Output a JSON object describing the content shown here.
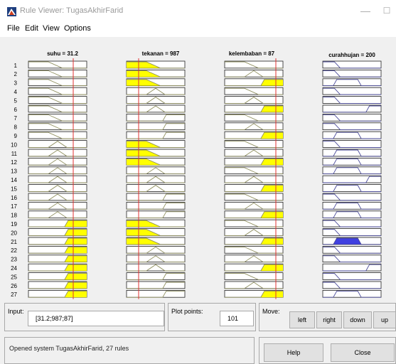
{
  "window": {
    "title": "Rule Viewer: TugasAkhirFarid",
    "minimize_glyph": "—",
    "maximize_glyph": "☐",
    "close_glyph": "✕"
  },
  "menu": [
    "File",
    "Edit",
    "View",
    "Options"
  ],
  "columns": [
    {
      "header": "suhu = 31.2",
      "input_value": 31.2,
      "range": [
        0,
        100
      ]
    },
    {
      "header": "tekanan = 987",
      "input_value": 987,
      "range": [
        0,
        100
      ]
    },
    {
      "header": "kelembaban = 87",
      "input_value": 87,
      "range": [
        0,
        100
      ]
    },
    {
      "header": "curahhujan = 200",
      "range": [
        0,
        100
      ]
    }
  ],
  "rules": [
    {
      "n": "1",
      "in": [
        {
          "mf": "low",
          "f": 0
        },
        {
          "mf": "low",
          "f": 1
        },
        {
          "mf": "low",
          "f": 0
        }
      ],
      "out": {
        "mf": "low",
        "f": 0
      }
    },
    {
      "n": "2",
      "in": [
        {
          "mf": "low",
          "f": 0
        },
        {
          "mf": "low",
          "f": 1
        },
        {
          "mf": "mid",
          "f": 0
        }
      ],
      "out": {
        "mf": "low",
        "f": 0
      }
    },
    {
      "n": "3",
      "in": [
        {
          "mf": "low",
          "f": 0
        },
        {
          "mf": "low",
          "f": 1
        },
        {
          "mf": "high",
          "f": 1
        }
      ],
      "out": {
        "mf": "mid",
        "f": 0
      }
    },
    {
      "n": "4",
      "in": [
        {
          "mf": "low",
          "f": 0
        },
        {
          "mf": "mid",
          "f": 0
        },
        {
          "mf": "low",
          "f": 0
        }
      ],
      "out": {
        "mf": "low",
        "f": 0
      }
    },
    {
      "n": "5",
      "in": [
        {
          "mf": "low",
          "f": 0
        },
        {
          "mf": "mid",
          "f": 0
        },
        {
          "mf": "mid",
          "f": 0
        }
      ],
      "out": {
        "mf": "low",
        "f": 0
      }
    },
    {
      "n": "6",
      "in": [
        {
          "mf": "low",
          "f": 0
        },
        {
          "mf": "mid",
          "f": 0
        },
        {
          "mf": "high",
          "f": 1
        }
      ],
      "out": {
        "mf": "high",
        "f": 0
      }
    },
    {
      "n": "7",
      "in": [
        {
          "mf": "low",
          "f": 0
        },
        {
          "mf": "high",
          "f": 0
        },
        {
          "mf": "low",
          "f": 0
        }
      ],
      "out": {
        "mf": "low",
        "f": 0
      }
    },
    {
      "n": "8",
      "in": [
        {
          "mf": "low",
          "f": 0
        },
        {
          "mf": "high",
          "f": 0
        },
        {
          "mf": "mid",
          "f": 0
        }
      ],
      "out": {
        "mf": "low",
        "f": 0
      }
    },
    {
      "n": "9",
      "in": [
        {
          "mf": "low",
          "f": 0
        },
        {
          "mf": "high",
          "f": 0
        },
        {
          "mf": "high",
          "f": 1
        }
      ],
      "out": {
        "mf": "mid",
        "f": 0
      }
    },
    {
      "n": "10",
      "in": [
        {
          "mf": "mid",
          "f": 0
        },
        {
          "mf": "low",
          "f": 1
        },
        {
          "mf": "low",
          "f": 0
        }
      ],
      "out": {
        "mf": "low",
        "f": 0
      }
    },
    {
      "n": "11",
      "in": [
        {
          "mf": "mid",
          "f": 0
        },
        {
          "mf": "low",
          "f": 1
        },
        {
          "mf": "mid",
          "f": 0
        }
      ],
      "out": {
        "mf": "mid",
        "f": 0
      }
    },
    {
      "n": "12",
      "in": [
        {
          "mf": "mid",
          "f": 0
        },
        {
          "mf": "low",
          "f": 1
        },
        {
          "mf": "high",
          "f": 1
        }
      ],
      "out": {
        "mf": "mid",
        "f": 0
      }
    },
    {
      "n": "13",
      "in": [
        {
          "mf": "mid",
          "f": 0
        },
        {
          "mf": "mid",
          "f": 0
        },
        {
          "mf": "low",
          "f": 0
        }
      ],
      "out": {
        "mf": "mid",
        "f": 0
      }
    },
    {
      "n": "14",
      "in": [
        {
          "mf": "mid",
          "f": 0
        },
        {
          "mf": "mid",
          "f": 0
        },
        {
          "mf": "mid",
          "f": 0
        }
      ],
      "out": {
        "mf": "high",
        "f": 0
      }
    },
    {
      "n": "15",
      "in": [
        {
          "mf": "mid",
          "f": 0
        },
        {
          "mf": "mid",
          "f": 0
        },
        {
          "mf": "high",
          "f": 1
        }
      ],
      "out": {
        "mf": "mid",
        "f": 0
      }
    },
    {
      "n": "16",
      "in": [
        {
          "mf": "mid",
          "f": 0
        },
        {
          "mf": "high",
          "f": 0
        },
        {
          "mf": "low",
          "f": 0
        }
      ],
      "out": {
        "mf": "low",
        "f": 0
      }
    },
    {
      "n": "17",
      "in": [
        {
          "mf": "mid",
          "f": 0
        },
        {
          "mf": "high",
          "f": 0
        },
        {
          "mf": "mid",
          "f": 0
        }
      ],
      "out": {
        "mf": "mid",
        "f": 0
      }
    },
    {
      "n": "18",
      "in": [
        {
          "mf": "mid",
          "f": 0
        },
        {
          "mf": "high",
          "f": 0
        },
        {
          "mf": "high",
          "f": 1
        }
      ],
      "out": {
        "mf": "mid",
        "f": 0
      }
    },
    {
      "n": "19",
      "in": [
        {
          "mf": "high",
          "f": 1
        },
        {
          "mf": "low",
          "f": 1
        },
        {
          "mf": "low",
          "f": 0
        }
      ],
      "out": {
        "mf": "low",
        "f": 0
      }
    },
    {
      "n": "20",
      "in": [
        {
          "mf": "high",
          "f": 1
        },
        {
          "mf": "low",
          "f": 1
        },
        {
          "mf": "mid",
          "f": 0
        }
      ],
      "out": {
        "mf": "low",
        "f": 0
      }
    },
    {
      "n": "21",
      "in": [
        {
          "mf": "high",
          "f": 1
        },
        {
          "mf": "low",
          "f": 1
        },
        {
          "mf": "high",
          "f": 1
        }
      ],
      "out": {
        "mf": "mid",
        "f": 1
      }
    },
    {
      "n": "22",
      "in": [
        {
          "mf": "high",
          "f": 1
        },
        {
          "mf": "mid",
          "f": 0
        },
        {
          "mf": "low",
          "f": 0
        }
      ],
      "out": {
        "mf": "low",
        "f": 0
      }
    },
    {
      "n": "23",
      "in": [
        {
          "mf": "high",
          "f": 1
        },
        {
          "mf": "mid",
          "f": 0
        },
        {
          "mf": "mid",
          "f": 0
        }
      ],
      "out": {
        "mf": "low",
        "f": 0
      }
    },
    {
      "n": "24",
      "in": [
        {
          "mf": "high",
          "f": 1
        },
        {
          "mf": "mid",
          "f": 0
        },
        {
          "mf": "high",
          "f": 1
        }
      ],
      "out": {
        "mf": "high",
        "f": 0
      }
    },
    {
      "n": "25",
      "in": [
        {
          "mf": "high",
          "f": 1
        },
        {
          "mf": "high",
          "f": 0
        },
        {
          "mf": "low",
          "f": 0
        }
      ],
      "out": {
        "mf": "low",
        "f": 0
      }
    },
    {
      "n": "26",
      "in": [
        {
          "mf": "high",
          "f": 1
        },
        {
          "mf": "high",
          "f": 0
        },
        {
          "mf": "mid",
          "f": 0
        }
      ],
      "out": {
        "mf": "low",
        "f": 0
      }
    },
    {
      "n": "27",
      "in": [
        {
          "mf": "high",
          "f": 1
        },
        {
          "mf": "high",
          "f": 0
        },
        {
          "mf": "high",
          "f": 1
        }
      ],
      "out": {
        "mf": "mid",
        "f": 0
      }
    }
  ],
  "colors": {
    "input_fill": "#ffff00",
    "output_fill": "#4040e0",
    "input_line": "#909060",
    "output_line": "#4a4a9a",
    "cursor": "#e03030"
  },
  "bottom": {
    "input_label": "Input:",
    "input_value": "[31.2;987;87]",
    "plot_points_label": "Plot points:",
    "plot_points_value": "101",
    "move_label": "Move:",
    "buttons": {
      "left": "left",
      "right": "right",
      "down": "down",
      "up": "up",
      "help": "Help",
      "close": "Close"
    },
    "status": "Opened system TugasAkhirFarid, 27 rules"
  }
}
